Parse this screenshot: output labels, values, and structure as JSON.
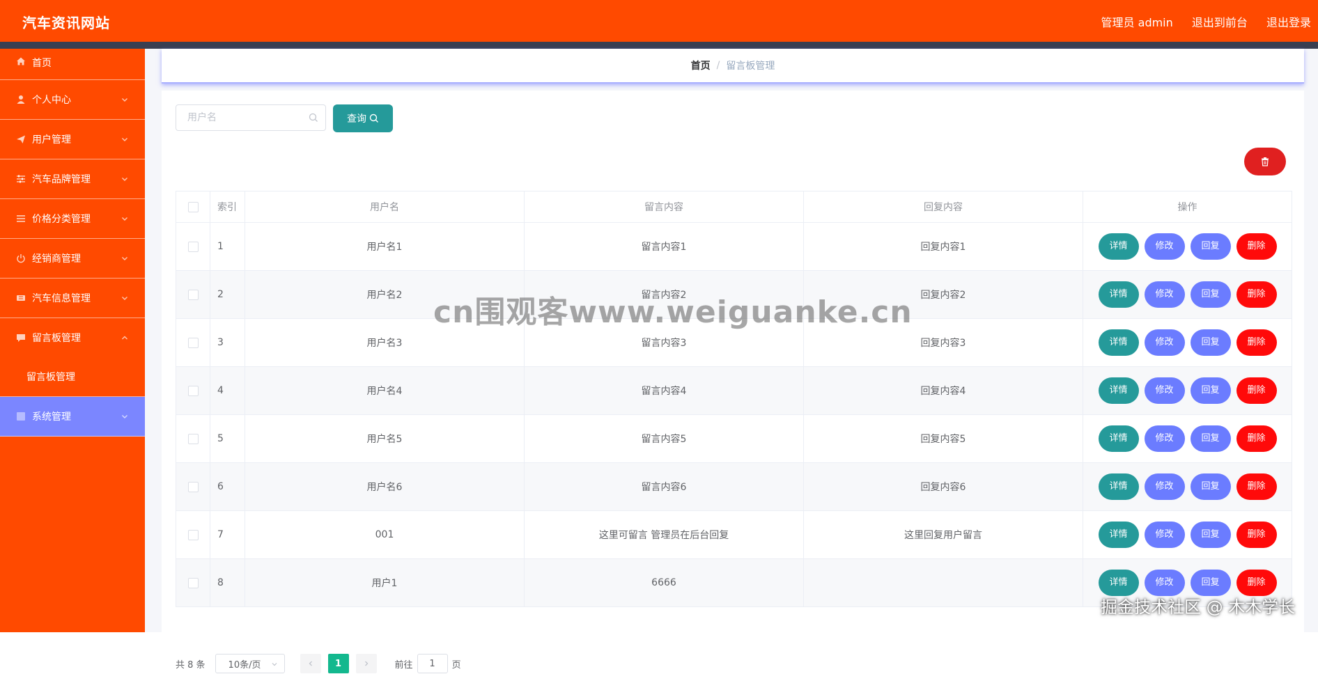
{
  "header": {
    "site_title": "汽车资讯网站",
    "admin_label": "管理员 admin",
    "exit_front_label": "退出到前台",
    "logout_label": "退出登录"
  },
  "sidebar": {
    "items": [
      {
        "label": "首页",
        "icon": "home-icon"
      },
      {
        "label": "个人中心",
        "icon": "user-icon"
      },
      {
        "label": "用户管理",
        "icon": "paper-plane-icon"
      },
      {
        "label": "汽车品牌管理",
        "icon": "sliders-icon"
      },
      {
        "label": "价格分类管理",
        "icon": "list-icon"
      },
      {
        "label": "经销商管理",
        "icon": "power-icon"
      },
      {
        "label": "汽车信息管理",
        "icon": "ticket-icon"
      },
      {
        "label": "留言板管理",
        "icon": "chat-icon",
        "expanded": true
      },
      {
        "label": "系统管理",
        "icon": "grid-icon",
        "active": true
      }
    ],
    "submenu_label": "留言板管理"
  },
  "breadcrumb": {
    "home": "首页",
    "separator": "/",
    "current": "留言板管理"
  },
  "search": {
    "placeholder": "用户名",
    "button_label": "查询"
  },
  "table": {
    "headers": {
      "index": "索引",
      "username": "用户名",
      "message": "留言内容",
      "reply": "回复内容",
      "actions": "操作"
    },
    "rows": [
      {
        "index": "1",
        "username": "用户名1",
        "message": "留言内容1",
        "reply": "回复内容1"
      },
      {
        "index": "2",
        "username": "用户名2",
        "message": "留言内容2",
        "reply": "回复内容2"
      },
      {
        "index": "3",
        "username": "用户名3",
        "message": "留言内容3",
        "reply": "回复内容3"
      },
      {
        "index": "4",
        "username": "用户名4",
        "message": "留言内容4",
        "reply": "回复内容4"
      },
      {
        "index": "5",
        "username": "用户名5",
        "message": "留言内容5",
        "reply": "回复内容5"
      },
      {
        "index": "6",
        "username": "用户名6",
        "message": "留言内容6",
        "reply": "回复内容6"
      },
      {
        "index": "7",
        "username": "001",
        "message": "这里可留言 管理员在后台回复",
        "reply": "这里回复用户留言"
      },
      {
        "index": "8",
        "username": "用户1",
        "message": "6666",
        "reply": ""
      }
    ],
    "action_labels": {
      "detail": "详情",
      "edit": "修改",
      "reply": "回复",
      "delete": "删除"
    }
  },
  "pagination": {
    "total": "共 8 条",
    "page_size": "10条/页",
    "current_page": "1",
    "goto_label": "前往",
    "goto_value": "1",
    "page_suffix": "页"
  },
  "overlay": {
    "watermark": "cn围观客www.weiguanke.cn",
    "community_tag": "掘金技术社区 @ 木木学长"
  },
  "colors": {
    "primary": "#ff4a00",
    "strip": "#3a3f51",
    "active_menu": "#7b86ff",
    "teal": "#259a9a",
    "blue": "#6b7cff",
    "red": "#ff0a0a",
    "pager_active": "#13b88e"
  }
}
